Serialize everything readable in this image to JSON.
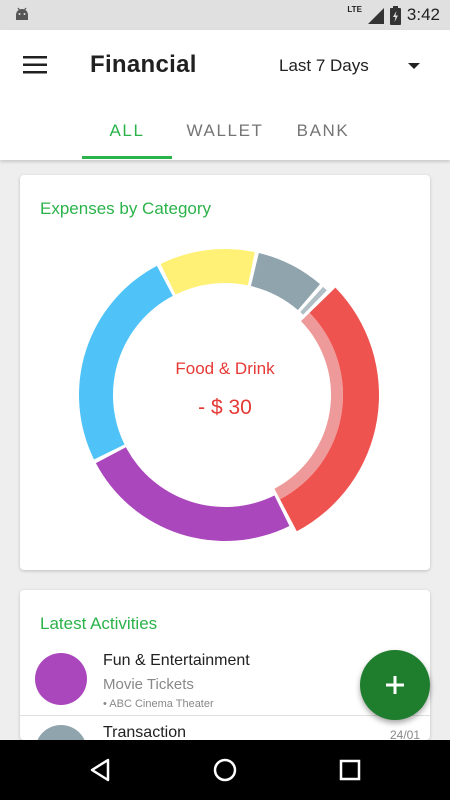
{
  "status_bar": {
    "time": "3:42",
    "network": "LTE",
    "icons": [
      "android-icon",
      "signal-icon",
      "battery-icon"
    ]
  },
  "header": {
    "title": "Financial",
    "period": "Last 7 Days",
    "tabs": [
      {
        "label": "ALL",
        "active": true
      },
      {
        "label": "WALLET"
      },
      {
        "label": "BANK"
      }
    ]
  },
  "expenses_card": {
    "title": "Expenses by Category",
    "selected_category": "Food & Drink",
    "selected_amount": "- $ 30"
  },
  "chart_data": {
    "type": "pie",
    "donut": true,
    "selected": "Food & Drink",
    "slices": [
      {
        "color": "#fff176",
        "value": 11
      },
      {
        "color": "#90a4ae",
        "value": 8
      },
      {
        "color": "#b0bec5",
        "value": 1
      },
      {
        "label": "Food & Drink",
        "color": "#ef5350",
        "value": 30
      },
      {
        "color": "#ab47bc",
        "value": 25
      },
      {
        "color": "#4fc3f7",
        "value": 25
      }
    ]
  },
  "activities_card": {
    "title": "Latest Activities",
    "items": [
      {
        "name": "Fun & Entertainment",
        "subtitle": "Movie Tickets",
        "meta": "• ABC Cinema Theater",
        "date": "",
        "color": "#ab47bc"
      },
      {
        "name": "Transaction",
        "subtitle": "",
        "meta": "",
        "date": "24/01",
        "color": "#90a4ae"
      }
    ]
  },
  "fab": {
    "icon": "plus-icon"
  },
  "nav": {
    "icons": [
      "back-icon",
      "home-icon",
      "recents-icon"
    ]
  }
}
